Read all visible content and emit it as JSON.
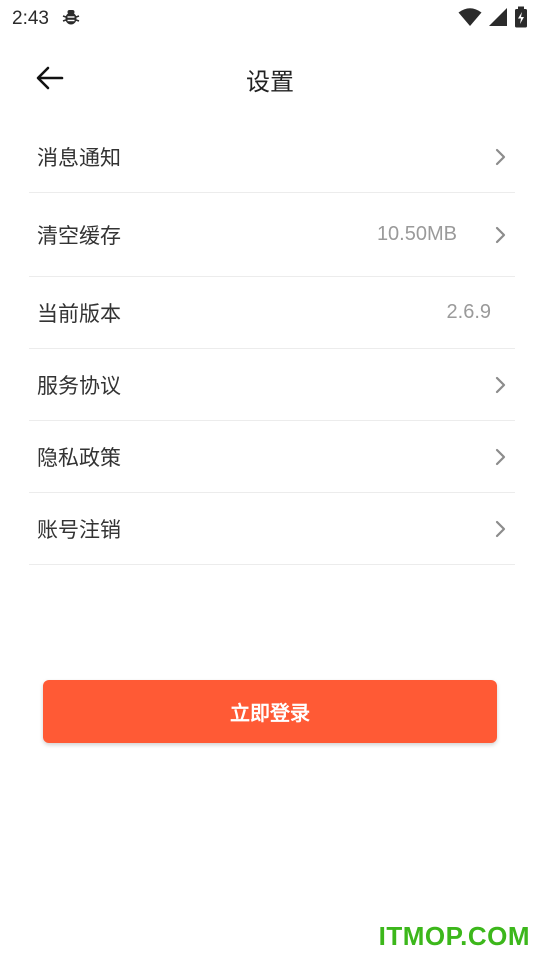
{
  "status_bar": {
    "time": "2:43",
    "icons": [
      "bug-icon",
      "wifi-icon",
      "signal-icon",
      "battery-charging-icon"
    ]
  },
  "header": {
    "title": "设置",
    "back_icon": "arrow-left-icon"
  },
  "settings": {
    "items": [
      {
        "label": "消息通知",
        "value": "",
        "has_chevron": true
      },
      {
        "label": "清空缓存",
        "value": "10.50MB",
        "has_chevron": true
      },
      {
        "label": "当前版本",
        "value": "2.6.9",
        "has_chevron": false
      },
      {
        "label": "服务协议",
        "value": "",
        "has_chevron": true
      },
      {
        "label": "隐私政策",
        "value": "",
        "has_chevron": true
      },
      {
        "label": "账号注销",
        "value": "",
        "has_chevron": true
      }
    ]
  },
  "login_button": {
    "label": "立即登录"
  },
  "watermark": {
    "text": "ITMOP.COM"
  },
  "colors": {
    "accent": "#ff5a35",
    "watermark": "#3cb71b",
    "divider": "#ececec",
    "value_text": "#9a9a9a"
  }
}
